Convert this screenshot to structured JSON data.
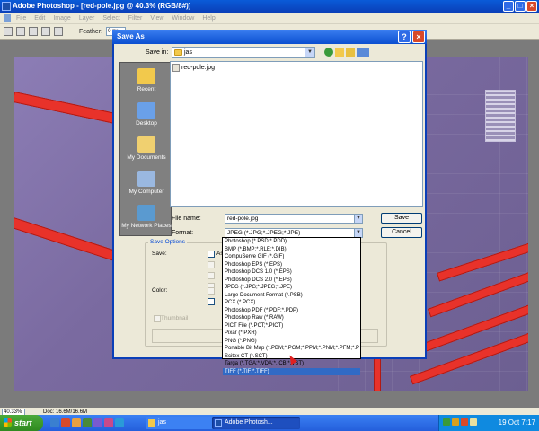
{
  "app": {
    "title": "Adobe Photoshop - [red-pole.jpg @ 40.3% (RGB/8#)]",
    "menu": [
      "File",
      "Edit",
      "Image",
      "Layer",
      "Select",
      "Filter",
      "View",
      "Window",
      "Help"
    ],
    "options_bar": {
      "feather_label": "Feather:",
      "feather_value": "0 px"
    },
    "status": {
      "zoom": "40.33%",
      "doc_info": "Doc: 16.6M/16.6M"
    }
  },
  "dialog": {
    "title": "Save As",
    "save_in_label": "Save in:",
    "save_in_value": "jas",
    "places": [
      {
        "label": "Recent",
        "icon": "recent-folder-icon"
      },
      {
        "label": "Desktop",
        "icon": "desktop-icon"
      },
      {
        "label": "My Documents",
        "icon": "my-documents-icon"
      },
      {
        "label": "My Computer",
        "icon": "my-computer-icon"
      },
      {
        "label": "My Network Places",
        "icon": "network-places-icon"
      }
    ],
    "files": [
      "red-pole.jpg"
    ],
    "file_name_label": "File name:",
    "file_name_value": "red-pole.jpg",
    "format_label": "Format:",
    "format_value": "JPEG (*.JPG;*.JPEG;*.JPE)",
    "save_button": "Save",
    "cancel_button": "Cancel",
    "save_options_label": "Save Options",
    "save_label": "Save:",
    "color_label": "Color:",
    "as_copy_label": "As",
    "thumbnail_label": "Thumbnail",
    "format_options": [
      "Photoshop (*.PSD;*.PDD)",
      "BMP (*.BMP;*.RLE;*.DIB)",
      "CompuServe GIF (*.GIF)",
      "Photoshop EPS (*.EPS)",
      "Photoshop DCS 1.0 (*.EPS)",
      "Photoshop DCS 2.0 (*.EPS)",
      "JPEG (*.JPG;*.JPEG;*.JPE)",
      "Large Document Format (*.PSB)",
      "PCX (*.PCX)",
      "Photoshop PDF (*.PDF;*.PDP)",
      "Photoshop Raw (*.RAW)",
      "PICT File (*.PCT;*.PICT)",
      "Pixar (*.PXR)",
      "PNG (*.PNG)",
      "Portable Bit Map (*.PBM;*.PGM;*.PPM;*.PNM;*.PFM;*.P",
      "Scitex CT (*.SCT)",
      "Targa (*.TGA;*.VDA;*.ICB;*.VST)",
      "TIFF (*.TIF;*.TIFF)"
    ],
    "highlighted_option": 17
  },
  "taskbar": {
    "start_label": "start",
    "tasks": [
      {
        "label": "jas",
        "icon": "folder-icon"
      },
      {
        "label": "Adobe Photosh...",
        "icon": "photoshop-icon"
      }
    ],
    "clock": "19 Oct 7:17"
  },
  "colors": {
    "accent": "#0a4ed0",
    "highlight": "#316ac5",
    "pole_red": "#e8322a"
  }
}
